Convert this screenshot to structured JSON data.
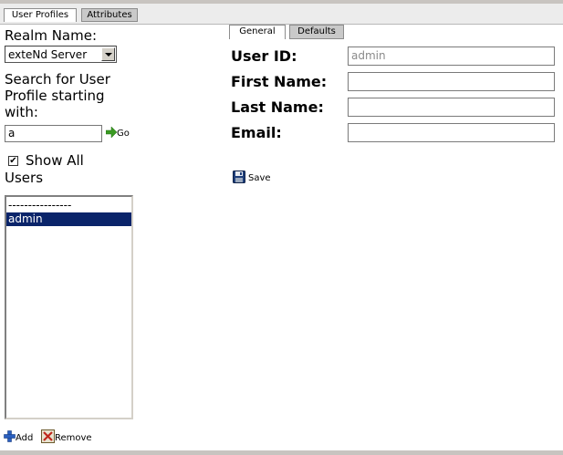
{
  "tabs": [
    {
      "label": "User Profiles",
      "active": true
    },
    {
      "label": "Attributes",
      "active": false
    }
  ],
  "left": {
    "realm_label": "Realm Name:",
    "realm_value": "exteNd Server",
    "search_label_1": "Search for User",
    "search_label_2": "Profile starting",
    "search_label_3": "with:",
    "search_value": "a",
    "go_label": "Go",
    "show_all_checked": true,
    "show_all_label": "Show All",
    "users_label": "Users",
    "users_list": [
      "----------------",
      "admin"
    ],
    "selected_user": "admin",
    "add_label": "Add",
    "remove_label": "Remove"
  },
  "right": {
    "tabs": [
      {
        "label": "General",
        "active": true
      },
      {
        "label": "Defaults",
        "active": false
      }
    ],
    "fields": [
      {
        "label": "User ID:",
        "value": "admin",
        "readonly": true
      },
      {
        "label": "First Name:",
        "value": ""
      },
      {
        "label": "Last Name:",
        "value": ""
      },
      {
        "label": "Email:",
        "value": ""
      }
    ],
    "save_label": "Save"
  },
  "colors": {
    "selection": "#0a246a",
    "tab_inactive": "#c9c9c9",
    "go_arrow": "#3a9a22",
    "add_plus": "#2a5fbf",
    "remove_x": "#c0281c"
  }
}
